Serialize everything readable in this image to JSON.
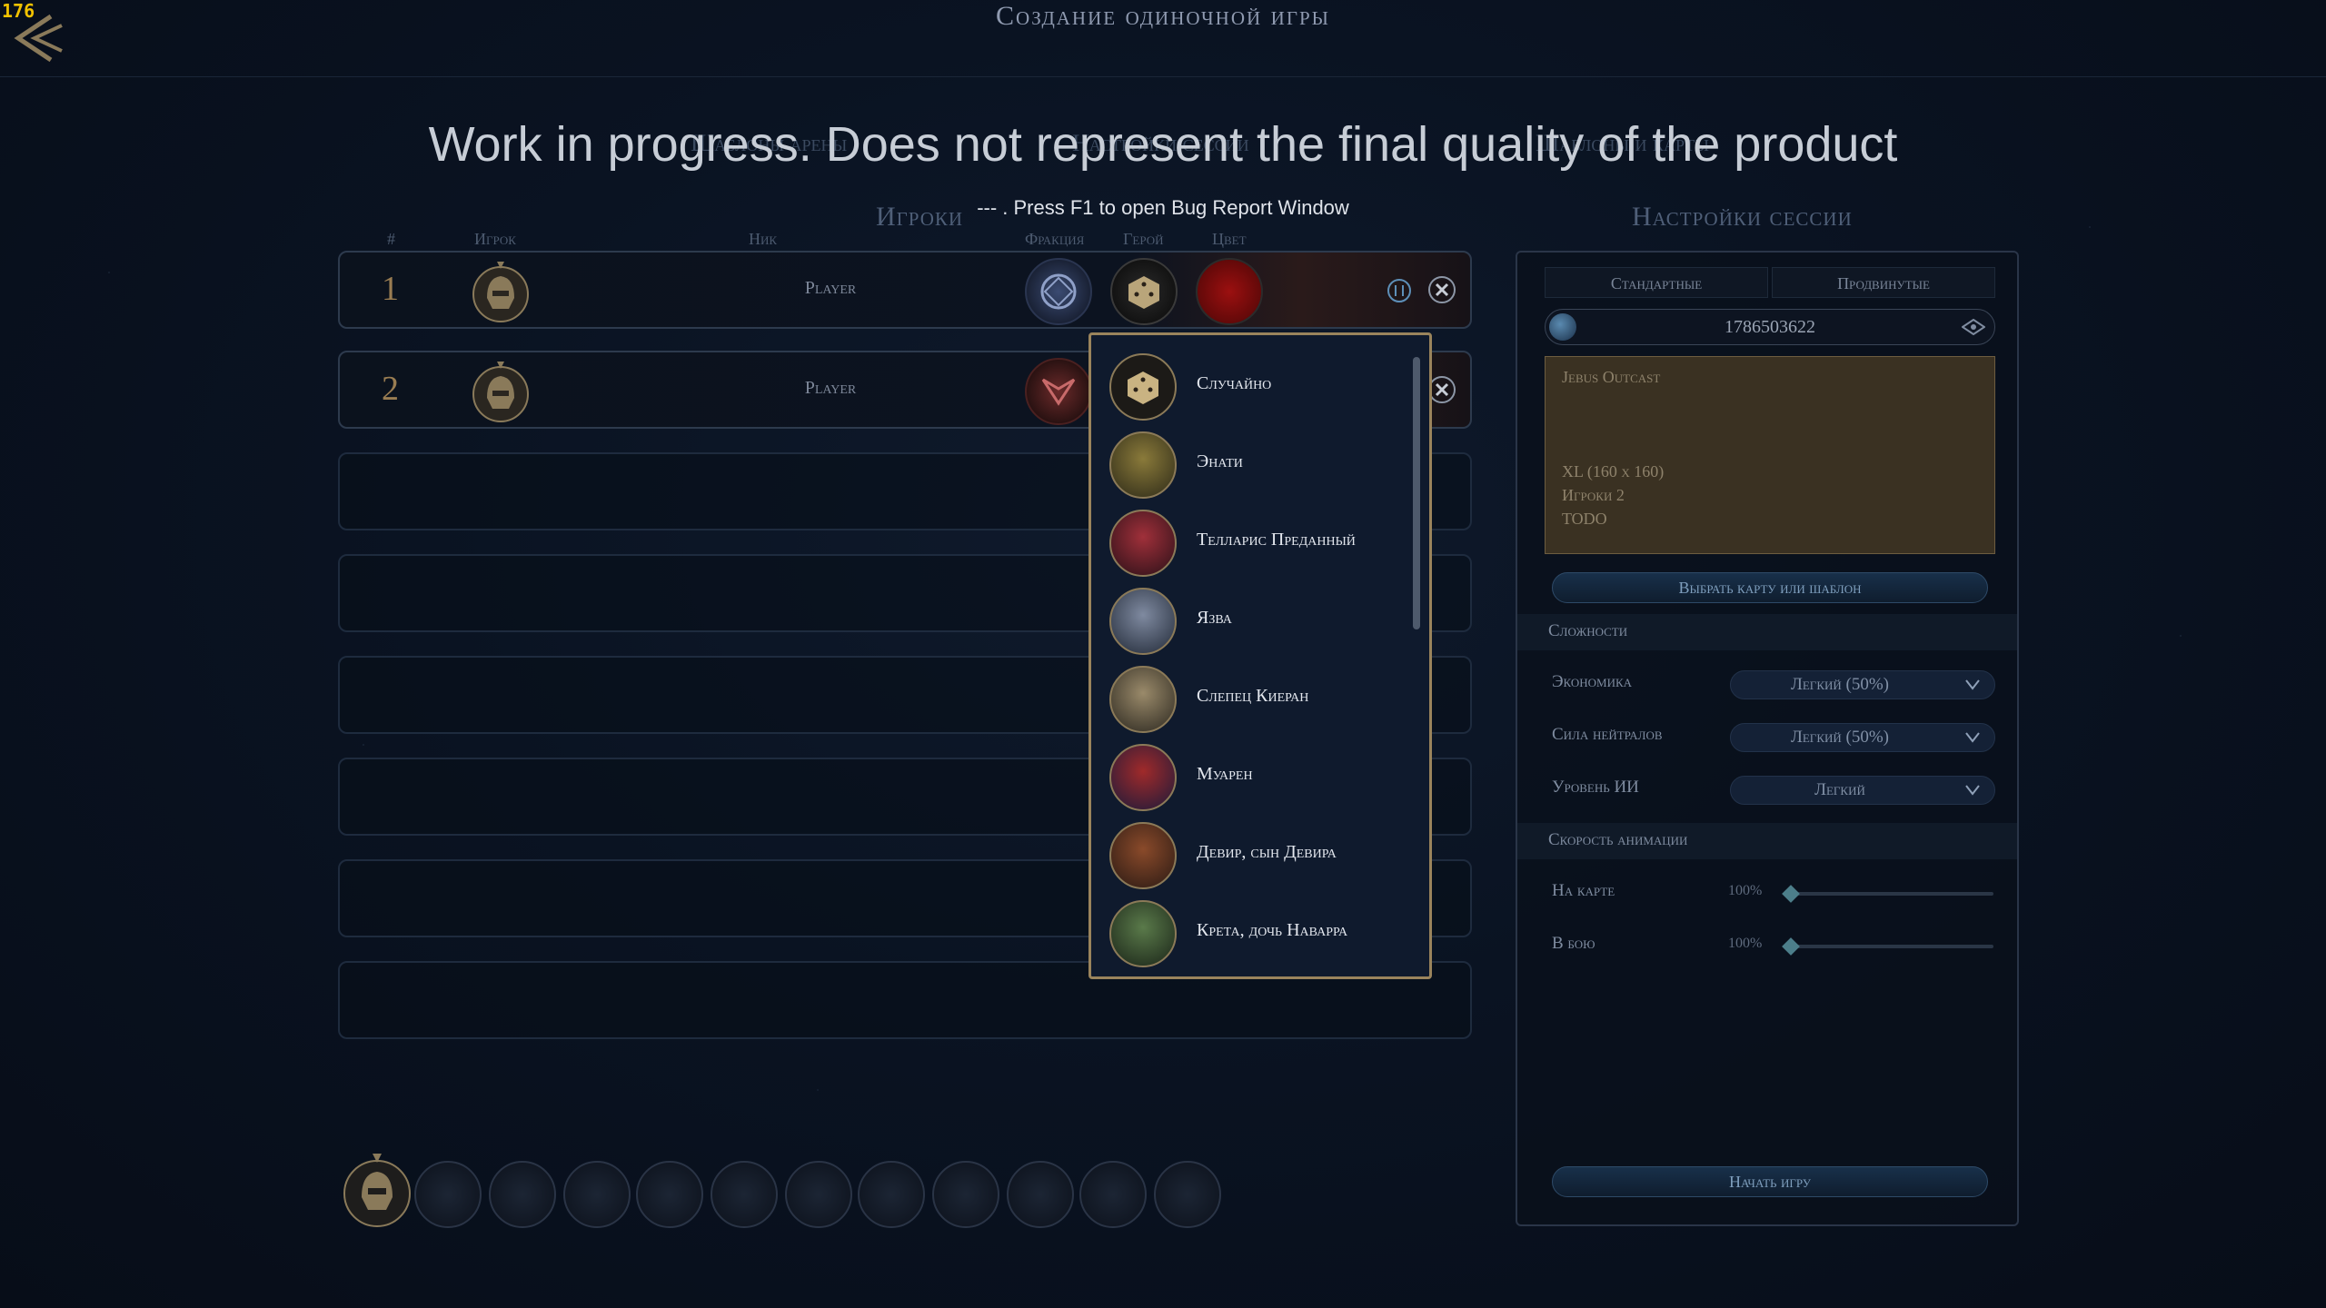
{
  "fps": "176",
  "title": "Создание одиночной игры",
  "overlay": {
    "wip": "Work in progress. Does not represent the final quality of the product",
    "bug": "--- . Press F1 to open Bug Report Window"
  },
  "ghost_tabs": [
    "Шаблоны арены",
    "Настройки сессии",
    "Шаблоны и карты"
  ],
  "players_section": "Игроки",
  "columns": {
    "num": "#",
    "player": "Игрок",
    "nick": "Ник",
    "faction": "Фракция",
    "hero": "Герой",
    "color": "Цвет"
  },
  "players": [
    {
      "num": "1",
      "nick": "Player"
    },
    {
      "num": "2",
      "nick": "Player"
    }
  ],
  "hero_dropdown": {
    "items": [
      {
        "label": "Случайно",
        "icon": "dice-icon"
      },
      {
        "label": "Энати",
        "icon": "hero-portrait-icon"
      },
      {
        "label": "Телларис Преданный",
        "icon": "hero-portrait-icon"
      },
      {
        "label": "Язва",
        "icon": "hero-portrait-icon"
      },
      {
        "label": "Слепец Киеран",
        "icon": "hero-portrait-icon"
      },
      {
        "label": "Муарен",
        "icon": "hero-portrait-icon"
      },
      {
        "label": "Девир, сын Девира",
        "icon": "hero-portrait-icon"
      },
      {
        "label": "Крета, дочь Наварра",
        "icon": "hero-portrait-icon"
      }
    ]
  },
  "session": {
    "title": "Настройки сессии",
    "tabs": [
      "Стандартные",
      "Продвинутые"
    ],
    "seed": "1786503622",
    "map": {
      "name": "Jebus Outcast",
      "size": "XL (160 x 160)",
      "players": "Игроки 2",
      "desc": "TODO"
    },
    "choose_map": "Выбрать карту или шаблон",
    "difficulty_group": "Сложности",
    "economy_label": "Экономика",
    "economy_value": "Легкий (50%)",
    "neutral_label": "Сила нейтралов",
    "neutral_value": "Легкий (50%)",
    "ai_label": "Уровень ИИ",
    "ai_value": "Легкий",
    "anim_group": "Скорость анимации",
    "map_anim_label": "На карте",
    "map_anim_value": "100%",
    "battle_anim_label": "В бою",
    "battle_anim_value": "100%",
    "start": "Начать игру"
  },
  "colors": {
    "accent_gold": "#9a845c",
    "player_red": "#9c1010",
    "panel_bg": "#0f1a2d"
  }
}
